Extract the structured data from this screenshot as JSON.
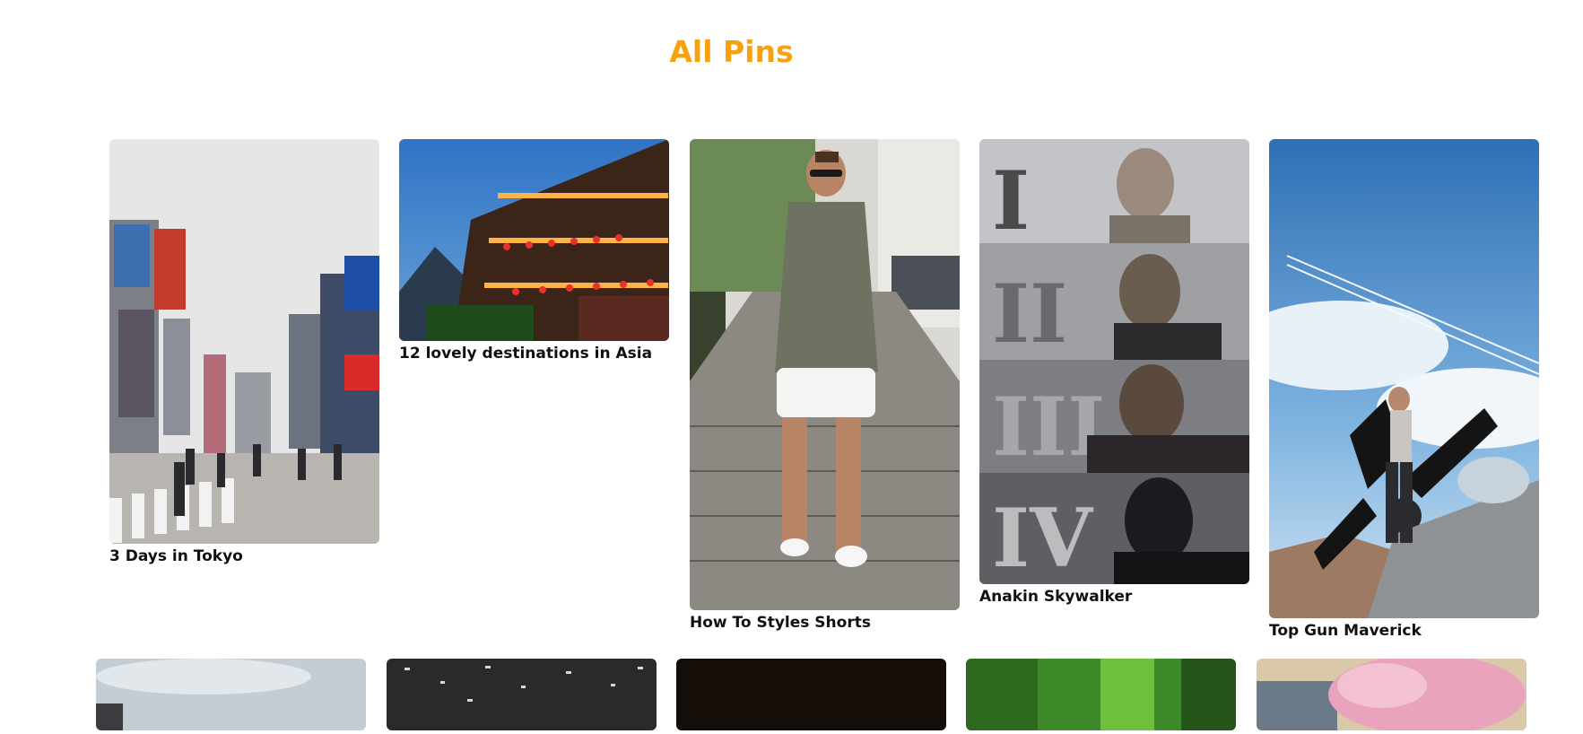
{
  "page": {
    "title": "All Pins"
  },
  "colors": {
    "title": "#f7a10f",
    "caption": "#111111"
  },
  "pins": [
    {
      "caption": "3 Days in Tokyo"
    },
    {
      "caption": "12 lovely destinations in Asia"
    },
    {
      "caption": "How To Styles Shorts"
    },
    {
      "caption": "Anakin Skywalker",
      "panel_numerals": [
        "I",
        "II",
        "III",
        "IV"
      ]
    },
    {
      "caption": "Top Gun Maverick"
    },
    {
      "caption": ""
    },
    {
      "caption": ""
    },
    {
      "caption": ""
    },
    {
      "caption": ""
    },
    {
      "caption": ""
    }
  ]
}
